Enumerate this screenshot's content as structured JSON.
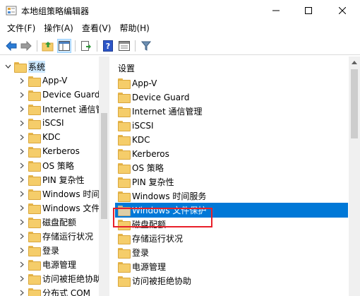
{
  "window": {
    "title": "本地组策略编辑器",
    "controls": {
      "minimize": "—",
      "maximize": "☐",
      "close": "✕"
    }
  },
  "menu": [
    "文件(F)",
    "操作(A)",
    "查看(V)",
    "帮助(H)"
  ],
  "toolbar": {
    "buttons": [
      "back-arrow-icon",
      "forward-arrow-icon",
      "folder-up-icon",
      "show-hide-tree-icon",
      "export-list-icon",
      "help-icon",
      "view-icon",
      "filter-icon"
    ]
  },
  "tree": {
    "root": "系统",
    "items": [
      "App-V",
      "Device Guard",
      "Internet 通信管",
      "iSCSI",
      "KDC",
      "Kerberos",
      "OS 策略",
      "PIN 复杂性",
      "Windows 时间",
      "Windows 文件",
      "磁盘配额",
      "存储运行状况",
      "登录",
      "电源管理",
      "访问被拒绝协助",
      "分布式 COM"
    ]
  },
  "list": {
    "heading": "设置",
    "items": [
      "App-V",
      "Device Guard",
      "Internet 通信管理",
      "iSCSI",
      "KDC",
      "Kerberos",
      "OS 策略",
      "PIN 复杂性",
      "Windows 时间服务",
      "Windows 文件保护",
      "磁盘配额",
      "存储运行状况",
      "登录",
      "电源管理",
      "访问被拒绝协助"
    ],
    "selected_index": 9
  },
  "colors": {
    "selection": "#0078d7",
    "highlight_box": "#e8202a",
    "folder": "#f5cd6a"
  }
}
